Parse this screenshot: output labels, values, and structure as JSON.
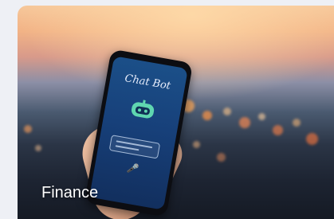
{
  "card": {
    "label": "Finance",
    "image": {
      "screen_title": "Chat Bot",
      "icons": [
        "chatbot-robot-icon",
        "microphone-icon"
      ]
    }
  }
}
